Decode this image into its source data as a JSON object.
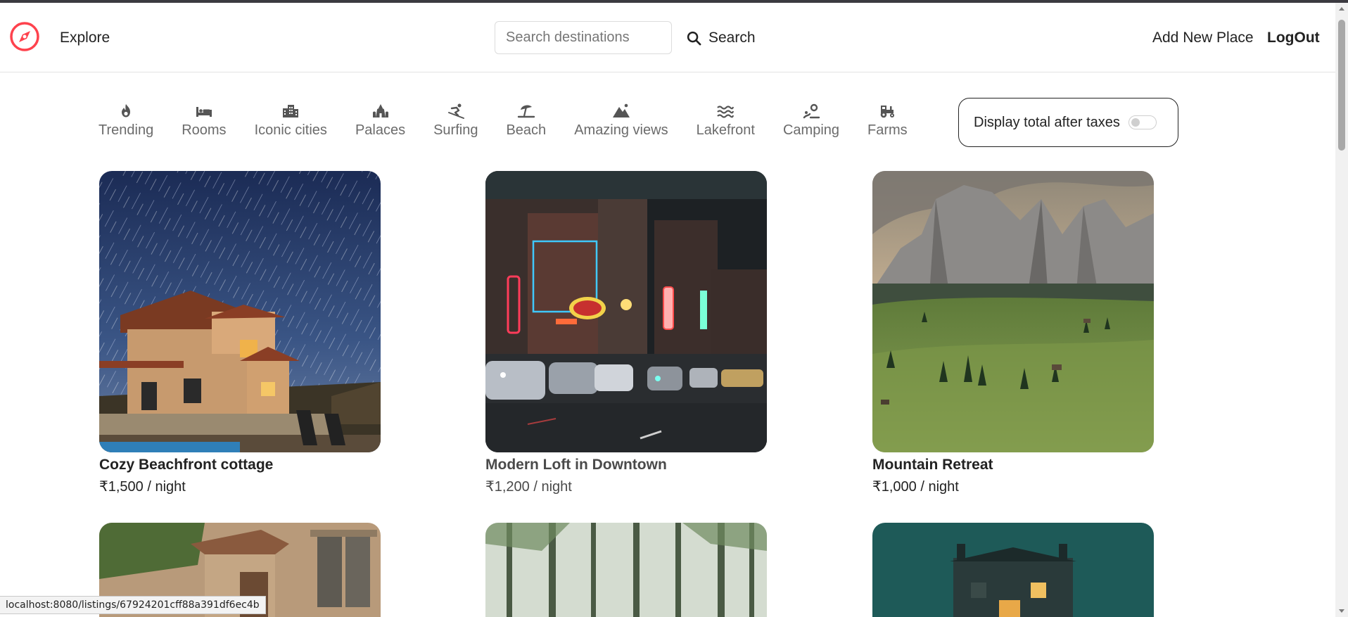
{
  "navbar": {
    "explore_label": "Explore",
    "search_placeholder": "Search destinations",
    "search_label": "Search",
    "add_place_label": "Add New Place",
    "logout_label": "LogOut",
    "brand_color": "#fe424d",
    "logo_icon": "compass-icon"
  },
  "filters": [
    {
      "label": "Trending",
      "icon": "fire-icon"
    },
    {
      "label": "Rooms",
      "icon": "bed-icon"
    },
    {
      "label": "Iconic cities",
      "icon": "city-icon"
    },
    {
      "label": "Palaces",
      "icon": "palace-icon"
    },
    {
      "label": "Surfing",
      "icon": "skiing-icon"
    },
    {
      "label": "Beach",
      "icon": "umbrella-beach-icon"
    },
    {
      "label": "Amazing views",
      "icon": "mountain-icon"
    },
    {
      "label": "Lakefront",
      "icon": "water-icon"
    },
    {
      "label": "Camping",
      "icon": "campground-icon"
    },
    {
      "label": "Farms",
      "icon": "tractor-icon"
    }
  ],
  "tax_toggle": {
    "label": "Display total after taxes",
    "enabled": false
  },
  "listings": [
    {
      "title": "Cozy Beachfront cottage",
      "price": "₹1,500 / night"
    },
    {
      "title": "Modern Loft in Downtown",
      "price": "₹1,200 / night"
    },
    {
      "title": "Mountain Retreat",
      "price": "₹1,000 / night"
    }
  ],
  "status_bar": {
    "url": "localhost:8080/listings/67924201cff88a391df6ec4b"
  }
}
